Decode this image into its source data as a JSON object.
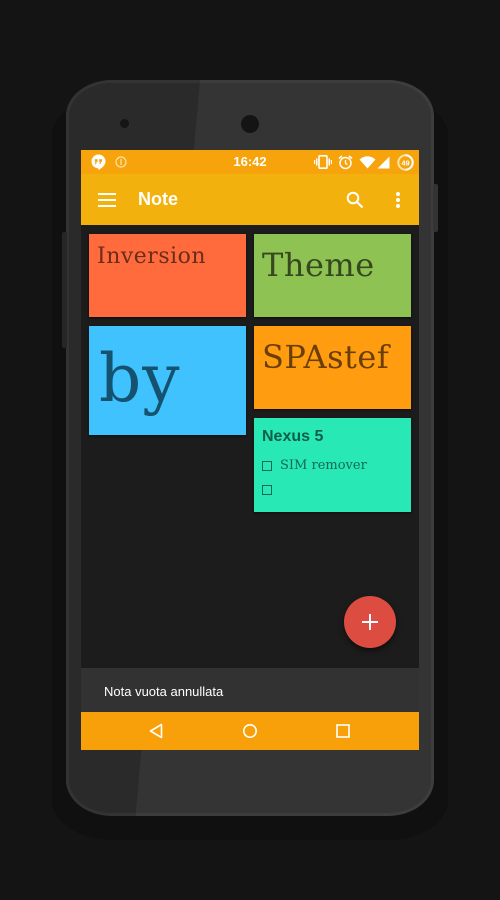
{
  "status_bar": {
    "time": "16:42",
    "battery_level": "49",
    "left_icons": [
      "hangouts-icon",
      "info-icon"
    ],
    "right_icons": [
      "vibrate-icon",
      "alarm-icon",
      "wifi-icon",
      "signal-icon",
      "battery-icon"
    ]
  },
  "app_bar": {
    "title": "Note",
    "menu_icon": "hamburger-menu-icon",
    "search_icon": "search-icon",
    "overflow_icon": "more-vert-icon"
  },
  "notes": [
    {
      "text": "Inversion",
      "color": "#ff6b3d"
    },
    {
      "text": "Theme",
      "color": "#8ec252"
    },
    {
      "text": "by",
      "color": "#40c2ff"
    },
    {
      "text": "SPAstef",
      "color": "#ff9c10"
    },
    {
      "title": "Nexus 5",
      "color": "#28e8b6",
      "checklist": [
        {
          "label": "SIM remover",
          "checked": false
        },
        {
          "label": "",
          "checked": false
        }
      ]
    }
  ],
  "fab": {
    "icon": "plus-icon",
    "color": "#dd4c40"
  },
  "snackbar": {
    "message": "Nota vuota annullata"
  },
  "nav_bar": {
    "back": "back-icon",
    "home": "home-icon",
    "recents": "recents-icon"
  },
  "colors": {
    "status_bar": "#f6a30c",
    "app_bar": "#f2b10c",
    "nav_bar": "#f7a00a",
    "background": "#1c1c1c"
  }
}
